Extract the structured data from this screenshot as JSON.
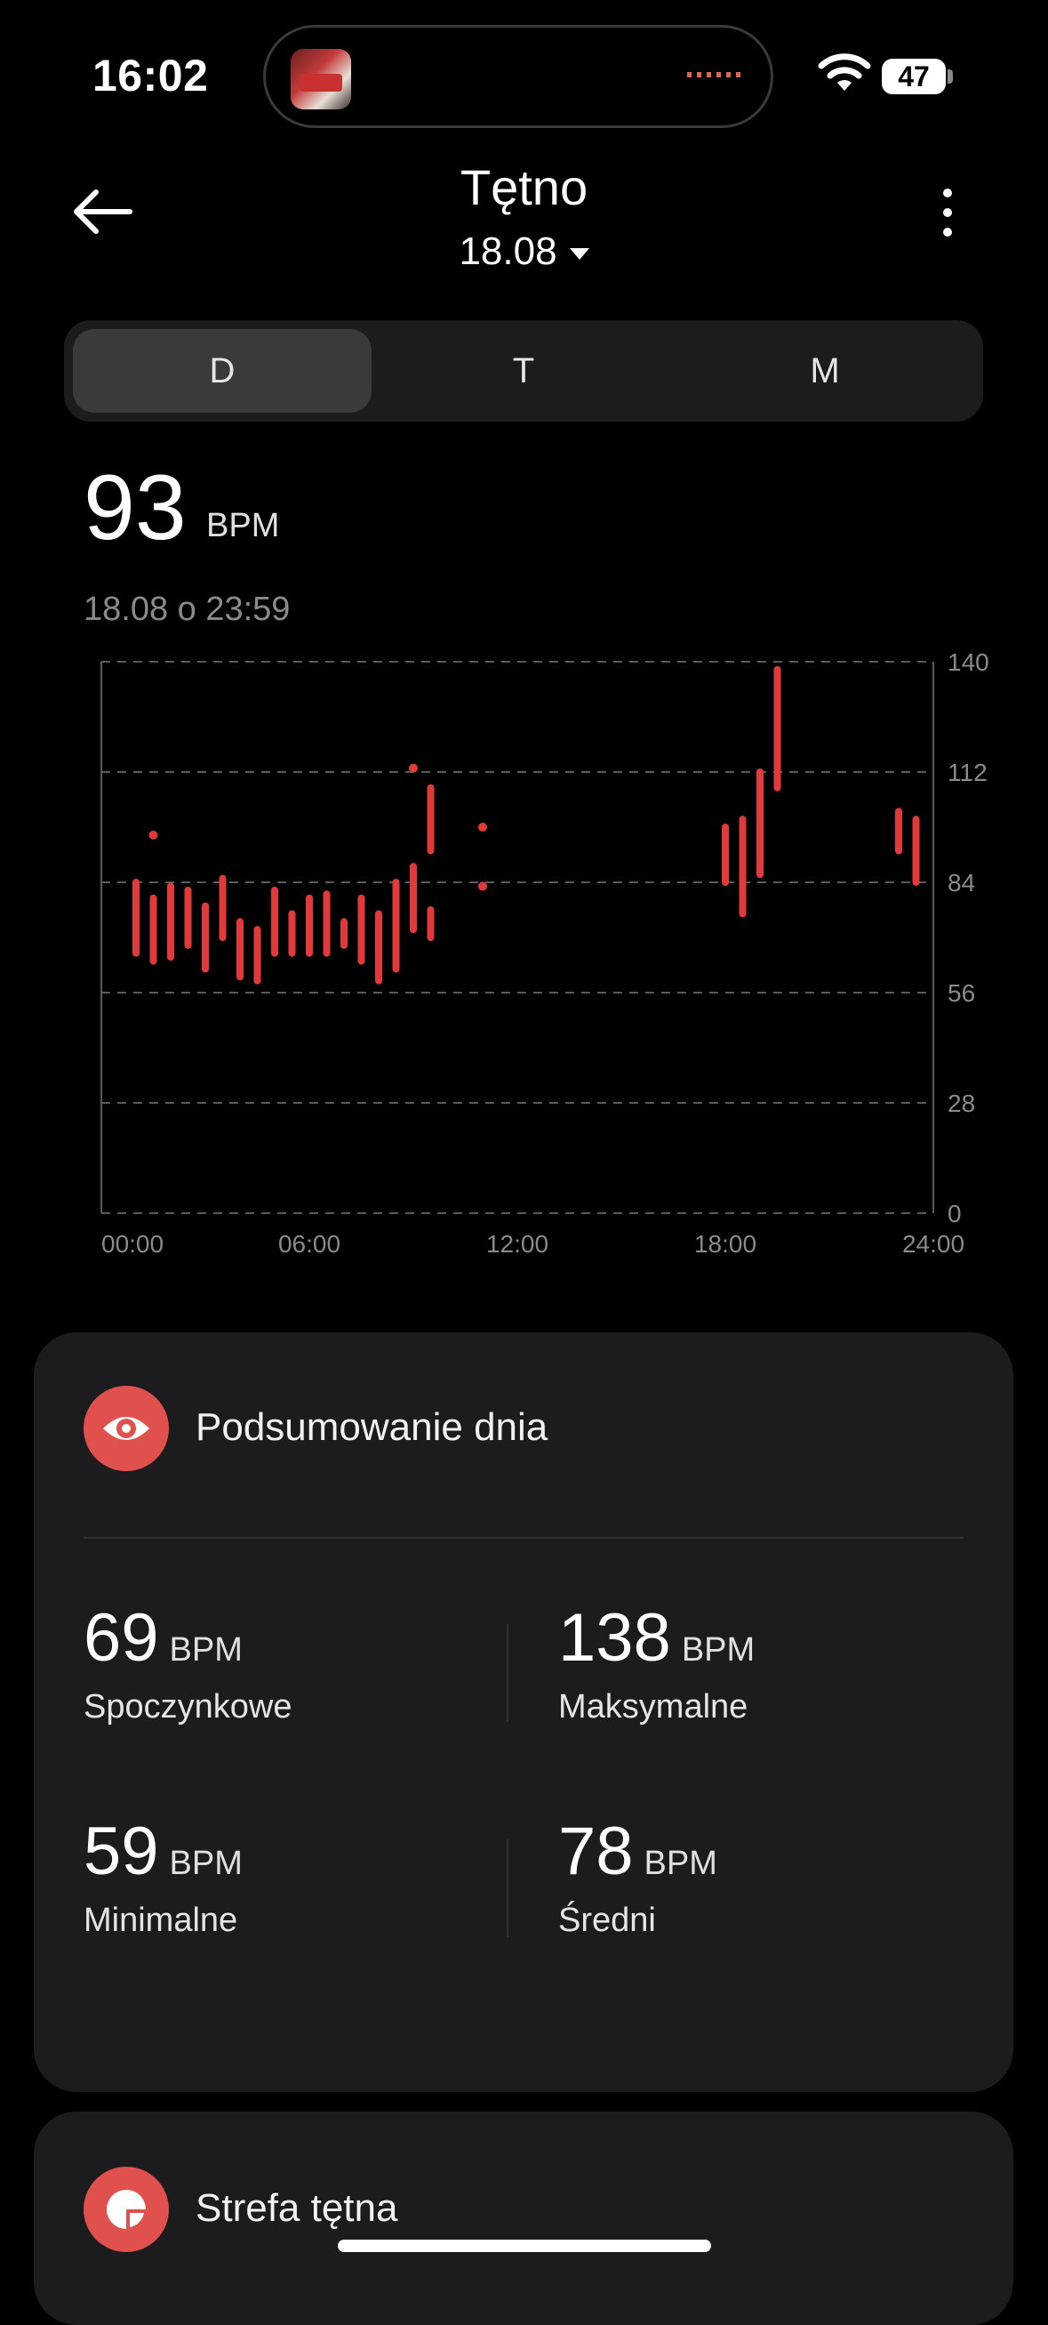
{
  "status": {
    "time": "16:02",
    "battery": "47"
  },
  "header": {
    "title": "Tętno",
    "date": "18.08"
  },
  "tabs": [
    {
      "label": "D",
      "active": true
    },
    {
      "label": "T",
      "active": false
    },
    {
      "label": "M",
      "active": false
    }
  ],
  "reading": {
    "value": "93",
    "unit": "BPM",
    "timestamp": "18.08 o 23:59"
  },
  "chart_data": {
    "type": "range-bar",
    "y_ticks": [
      "140",
      "112",
      "84",
      "56",
      "28",
      "0"
    ],
    "x_ticks": [
      "00:00",
      "06:00",
      "12:00",
      "18:00",
      "24:00"
    ],
    "ylim": [
      0,
      140
    ],
    "xlim": [
      0,
      24
    ],
    "grid": true,
    "ranges": [
      {
        "t": 1.0,
        "min": 66,
        "max": 84
      },
      {
        "t": 1.5,
        "min": 64,
        "max": 80
      },
      {
        "t": 2.0,
        "min": 65,
        "max": 83
      },
      {
        "t": 2.5,
        "min": 68,
        "max": 82
      },
      {
        "t": 3.0,
        "min": 62,
        "max": 78
      },
      {
        "t": 3.5,
        "min": 70,
        "max": 85
      },
      {
        "t": 4.0,
        "min": 60,
        "max": 74
      },
      {
        "t": 4.5,
        "min": 59,
        "max": 72
      },
      {
        "t": 5.0,
        "min": 66,
        "max": 82
      },
      {
        "t": 5.5,
        "min": 66,
        "max": 76
      },
      {
        "t": 6.0,
        "min": 66,
        "max": 80
      },
      {
        "t": 6.5,
        "min": 66,
        "max": 81
      },
      {
        "t": 7.0,
        "min": 68,
        "max": 74
      },
      {
        "t": 7.5,
        "min": 64,
        "max": 80
      },
      {
        "t": 8.0,
        "min": 59,
        "max": 76
      },
      {
        "t": 8.5,
        "min": 62,
        "max": 84
      },
      {
        "t": 9.0,
        "min": 72,
        "max": 88
      },
      {
        "t": 9.5,
        "min": 70,
        "max": 77
      },
      {
        "t": 9.5,
        "min": 92,
        "max": 108
      },
      {
        "t": 18.0,
        "min": 84,
        "max": 98
      },
      {
        "t": 18.5,
        "min": 76,
        "max": 100
      },
      {
        "t": 19.0,
        "min": 86,
        "max": 112
      },
      {
        "t": 19.5,
        "min": 108,
        "max": 138
      },
      {
        "t": 23.0,
        "min": 92,
        "max": 102
      },
      {
        "t": 23.5,
        "min": 84,
        "max": 100
      }
    ],
    "points": [
      {
        "t": 1.5,
        "v": 96
      },
      {
        "t": 9.0,
        "v": 113
      },
      {
        "t": 11.0,
        "v": 98
      },
      {
        "t": 11.0,
        "v": 83
      }
    ]
  },
  "summary": {
    "title": "Podsumowanie dnia",
    "icon": "eye-icon",
    "stats": [
      {
        "value": "69",
        "unit": "BPM",
        "label": "Spoczynkowe"
      },
      {
        "value": "138",
        "unit": "BPM",
        "label": "Maksymalne"
      },
      {
        "value": "59",
        "unit": "BPM",
        "label": "Minimalne"
      },
      {
        "value": "78",
        "unit": "BPM",
        "label": "Średni"
      }
    ]
  },
  "zones": {
    "title": "Strefa tętna",
    "icon": "pie-chart-icon"
  },
  "colors": {
    "accent": "#e23a3a",
    "card": "#1c1c1e",
    "background": "#000000"
  }
}
